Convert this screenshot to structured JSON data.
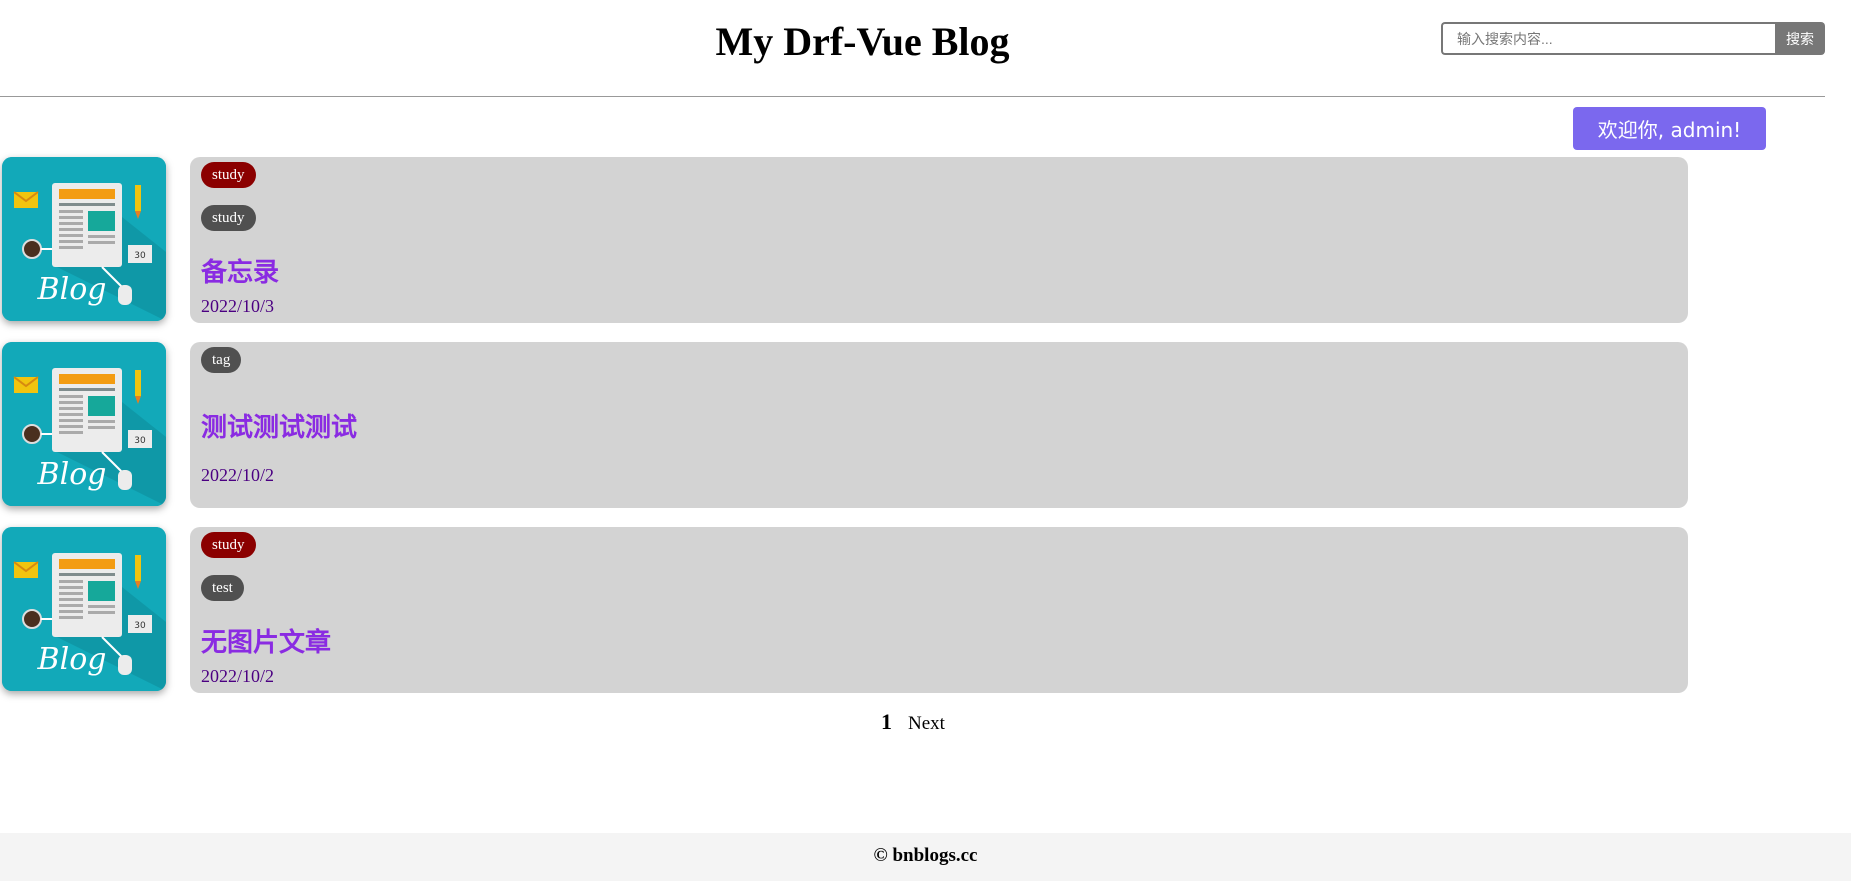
{
  "header": {
    "title": "My Drf-Vue Blog",
    "search": {
      "placeholder": "输入搜索内容...",
      "button_label": "搜索"
    }
  },
  "welcome": {
    "label": "欢迎你, admin!"
  },
  "posts": [
    {
      "category": "study",
      "tags": [
        "study"
      ],
      "title": "备忘录",
      "date": "2022/10/3",
      "thumbnail_icon": "blog-thumbnail-icon"
    },
    {
      "category": "",
      "tags": [
        "tag"
      ],
      "title": "测试测试测试",
      "date": "2022/10/2",
      "thumbnail_icon": "blog-thumbnail-icon"
    },
    {
      "category": "study",
      "tags": [
        "test"
      ],
      "title": "无图片文章",
      "date": "2022/10/2",
      "thumbnail_icon": "blog-thumbnail-icon"
    }
  ],
  "pagination": {
    "current": "1",
    "next_label": "Next"
  },
  "footer": {
    "text": "© bnblogs.cc"
  },
  "colors": {
    "accent": "#7b68ee",
    "title": "#8a2be2",
    "date": "#4b0082",
    "category_tag": "#8b0000",
    "tag": "#505050",
    "card": "#d3d3d3",
    "thumbnail": "#12a9b9"
  }
}
